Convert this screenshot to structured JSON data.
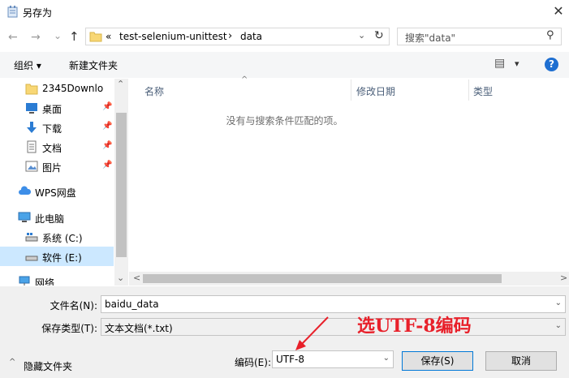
{
  "window": {
    "title": "另存为",
    "close_glyph": "✕"
  },
  "nav": {
    "back": "←",
    "forward": "→",
    "dropdown": "⌄",
    "up": "↑",
    "breadcrumb_chevron": "«",
    "breadcrumb": [
      "test-selenium-unittest",
      "data"
    ],
    "crumb_sep": "›",
    "refresh": "↻",
    "search_placeholder": "搜索\"data\"",
    "search_glyph": "⚲"
  },
  "toolbar": {
    "organize": "组织 ▾",
    "new_folder": "新建文件夹",
    "help": "?",
    "view_glyph": "▤",
    "view_arrow": "▾"
  },
  "sidebar": {
    "items": [
      {
        "label": "2345Downlo",
        "icon": "folder-icon",
        "pinned": false
      },
      {
        "label": "桌面",
        "icon": "desktop-icon",
        "pinned": true
      },
      {
        "label": "下载",
        "icon": "download-icon",
        "pinned": true
      },
      {
        "label": "文档",
        "icon": "document-icon",
        "pinned": true
      },
      {
        "label": "图片",
        "icon": "picture-icon",
        "pinned": true
      },
      {
        "label": "WPS网盘",
        "icon": "cloud-icon",
        "pinned": false
      },
      {
        "label": "此电脑",
        "icon": "computer-icon",
        "pinned": false
      },
      {
        "label": "系统 (C:)",
        "icon": "drive-icon",
        "pinned": false
      },
      {
        "label": "软件 (E:)",
        "icon": "drive-icon",
        "pinned": false,
        "selected": true
      },
      {
        "label": "网络",
        "icon": "network-icon",
        "pinned": false
      }
    ],
    "pin_glyph": "📌",
    "scroll_up": "⌃",
    "scroll_down": "⌄"
  },
  "files": {
    "columns": [
      "名称",
      "修改日期",
      "类型"
    ],
    "sort_glyph": "^",
    "empty_message": "没有与搜索条件匹配的项。",
    "hscroll_left": "<",
    "hscroll_right": ">"
  },
  "form": {
    "filename_label": "文件名(N):",
    "filename_value": "baidu_data",
    "filetype_label": "保存类型(T):",
    "filetype_value": "文本文档(*.txt)",
    "encoding_label": "编码(E):",
    "encoding_value": "UTF-8",
    "hide_folders": "隐藏文件夹",
    "hide_glyph": "^",
    "save": "保存(S)",
    "cancel": "取消",
    "combo_arrow": "⌄"
  },
  "annotation": {
    "text": "选UTF-8编码",
    "color": "#e8202a"
  }
}
